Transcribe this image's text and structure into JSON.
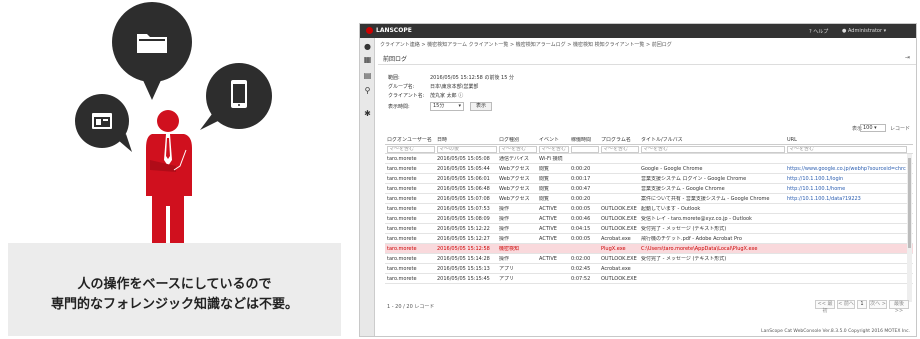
{
  "caption": {
    "line1": "人の操作をベースにしているので",
    "line2": "専門的なフォレンジック知識などは不要。"
  },
  "app": {
    "brand": "LANSCOPE",
    "help": "ヘルプ",
    "user": "Administrator",
    "breadcrumb": "クライアント連絡 > 機密検知アラーム クライアント一覧 > 機密検知アラームログ > 機密検知 検知クライアント一覧 > 前回ログ",
    "title": "前回ログ",
    "range_label": "範囲:",
    "range_value": "2016/05/05 15:12:58 の前後 15 分",
    "group_label": "グループ名:",
    "group_value": "日本\\東京本部\\営業部",
    "client_label": "クライアント名:",
    "client_value": "茂丸家 太郎",
    "interval_label": "表示時間:",
    "interval_value": "15分",
    "show_button": "表示",
    "page_size_label": "表示",
    "page_size_value": "100",
    "page_size_unit": "レコード",
    "columns": [
      "ログオンユーザー名",
      "日時",
      "ログ種別",
      "イベント",
      "稼働時間",
      "プログラム名",
      "タイトル/フルパス",
      "URL"
    ],
    "filters": [
      "マ〜を含む",
      "マ〜の後",
      "マ〜を含む",
      "マ〜を含む",
      "",
      "マ〜を含む",
      "マ〜を含む",
      "マ〜を含む"
    ],
    "rows": [
      [
        "taro.morete",
        "2016/05/05 15:05:08",
        "通信デバイス",
        "Wi-Fi 接続",
        "",
        "",
        "",
        ""
      ],
      [
        "taro.morete",
        "2016/05/05 15:05:44",
        "Webアクセス",
        "閲覧",
        "0:00:20",
        "",
        "Google - Google Chrome",
        "https://www.google.co.jp/webhp?sourceid=chrc"
      ],
      [
        "taro.morete",
        "2016/05/05 15:06:01",
        "Webアクセス",
        "閲覧",
        "0:00:17",
        "",
        "営業支援システム ログイン - Google Chrome",
        "http://10.1.100.1/login"
      ],
      [
        "taro.morete",
        "2016/05/05 15:06:48",
        "Webアクセス",
        "閲覧",
        "0:00:47",
        "",
        "営業支援システム - Google Chrome",
        "http://10.1.100.1/home"
      ],
      [
        "taro.morete",
        "2016/05/05 15:07:08",
        "Webアクセス",
        "閲覧",
        "0:00:20",
        "",
        "案件について共有 - 営業支援システム - Google Chrome",
        "http://10.1.100.1/data?19223"
      ],
      [
        "taro.morete",
        "2016/05/05 15:07:53",
        "操作",
        "ACTIVE",
        "0:00:05",
        "OUTLOOK.EXE",
        "起動しています - Outlook",
        ""
      ],
      [
        "taro.morete",
        "2016/05/05 15:08:09",
        "操作",
        "ACTIVE",
        "0:00:46",
        "OUTLOOK.EXE",
        "受信トレイ - taro.morete@xyz.co.jp - Outlook",
        ""
      ],
      [
        "taro.morete",
        "2016/05/05 15:12:22",
        "操作",
        "ACTIVE",
        "0:04:15",
        "OUTLOOK.EXE",
        "受付完了 - メッセージ (テキスト形式)",
        ""
      ],
      [
        "taro.morete",
        "2016/05/05 15:12:27",
        "操作",
        "ACTIVE",
        "0:00:05",
        "Acrobat.exe",
        "飛行機のチケット.pdf - Adobe Acrobat Pro",
        ""
      ],
      [
        "taro.morete",
        "2016/05/05 15:12:58",
        "機密検知",
        "",
        "",
        "PlugX.exe",
        "C:\\Users\\taro.morete\\AppData\\Local\\PlugX.exe",
        ""
      ],
      [
        "taro.morete",
        "2016/05/05 15:14:28",
        "操作",
        "ACTIVE",
        "0:02:00",
        "OUTLOOK.EXE",
        "受付完了 - メッセージ (テキスト形式)",
        ""
      ],
      [
        "taro.morete",
        "2016/05/05 15:15:13",
        "アプリ",
        "",
        "0:02:45",
        "Acrobat.exe",
        "",
        ""
      ],
      [
        "taro.morete",
        "2016/05/05 15:15:45",
        "アプリ",
        "",
        "0:07:52",
        "OUTLOOK.EXE",
        "",
        ""
      ]
    ],
    "record_count": "1 - 20 / 20 レコード",
    "pager": [
      "<< 最初",
      "< 前へ",
      "1",
      "次へ >",
      "最後 >>"
    ],
    "copyright": "LanScope Cat WebConsole Ver.8.3.5.0 Copyright 2016 MOTEX Inc."
  },
  "colors": {
    "accent_red": "#d0101e",
    "bubble": "#2d2d2d",
    "highlight_row": "#f9d9dc"
  }
}
